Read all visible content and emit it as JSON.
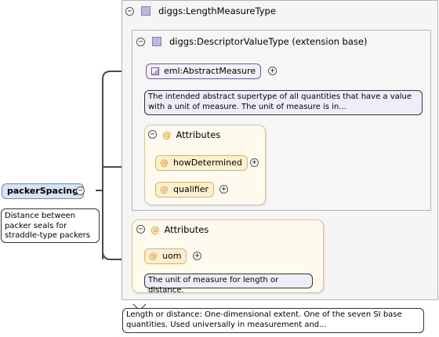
{
  "root_element": {
    "name": "packerSpacing",
    "doc": [
      "Distance between",
      "packer seals for",
      "straddle-type packers"
    ]
  },
  "length_measure_type": {
    "name": "diggs:LengthMeasureType",
    "doc": [
      "Length or distance: One-dimensional extent. One of the seven SI base",
      "quantities. Used universally in measurement and..."
    ]
  },
  "descriptor_value_type": {
    "name": "diggs:DescriptorValueType (extension base)"
  },
  "abstract_measure": {
    "name": "eml:AbstractMeasure",
    "doc": [
      "The intended abstract supertype of all quantities that have a value",
      "with a unit of measure. The unit of measure is in..."
    ]
  },
  "attributes_inner": {
    "label": "Attributes",
    "items": [
      {
        "name": "howDetermined"
      },
      {
        "name": "qualifier"
      }
    ]
  },
  "attributes_outer": {
    "label": "Attributes",
    "items": [
      {
        "name": "uom",
        "doc": "The unit of measure for length or distance."
      }
    ]
  },
  "symbols": {
    "collapse": "−",
    "expand": "+",
    "attribute": "@"
  },
  "colors": {
    "connector": "#4a4a4a",
    "element_fill": "#ece8f8",
    "attribute_fill": "#fdf0cf",
    "type_box_fill": "#f5f5f5"
  }
}
